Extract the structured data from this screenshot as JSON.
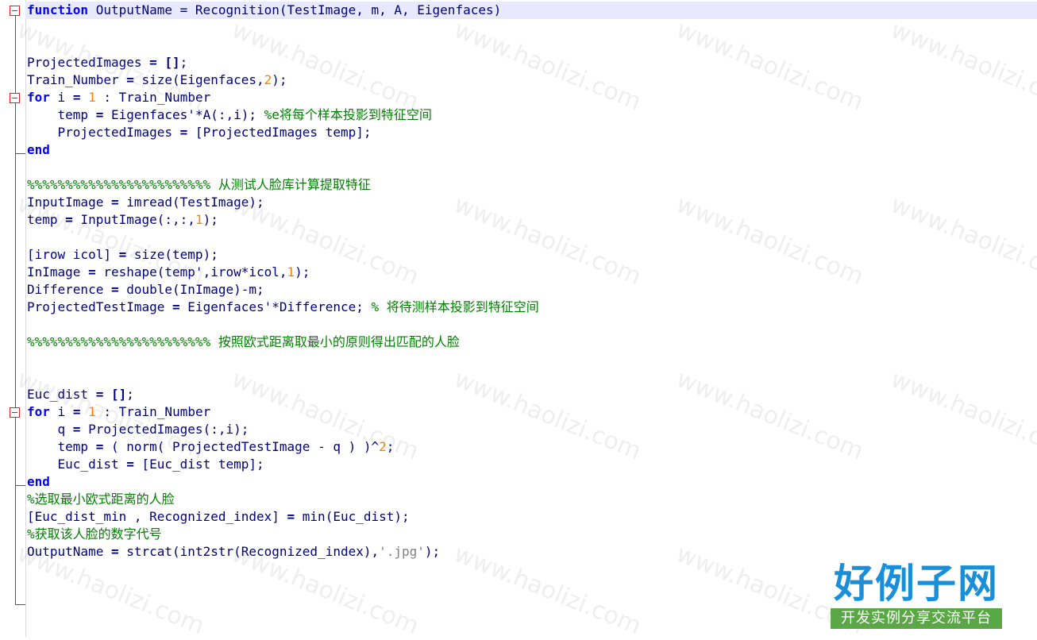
{
  "editor": {
    "lines": [
      [
        {
          "t": "kw",
          "v": "function"
        },
        {
          "t": "p",
          "v": " OutputName = Recognition(TestImage, m, A, Eigenfaces)"
        }
      ],
      [],
      [],
      [
        {
          "t": "p",
          "v": "ProjectedImages "
        },
        {
          "t": "op",
          "v": "= []"
        },
        {
          "t": "p",
          "v": ";"
        }
      ],
      [
        {
          "t": "p",
          "v": "Train_Number "
        },
        {
          "t": "op",
          "v": "="
        },
        {
          "t": "p",
          "v": " size(Eigenfaces,"
        },
        {
          "t": "num",
          "v": "2"
        },
        {
          "t": "p",
          "v": ");"
        }
      ],
      [
        {
          "t": "kw",
          "v": "for"
        },
        {
          "t": "p",
          "v": " i "
        },
        {
          "t": "op",
          "v": "="
        },
        {
          "t": "p",
          "v": " "
        },
        {
          "t": "num",
          "v": "1"
        },
        {
          "t": "p",
          "v": " : Train_Number"
        }
      ],
      [
        {
          "t": "p",
          "v": "    temp "
        },
        {
          "t": "op",
          "v": "="
        },
        {
          "t": "p",
          "v": " Eigenfaces'*A(:,i); "
        },
        {
          "t": "cm",
          "v": "%e将每个样本投影到特征空间"
        }
      ],
      [
        {
          "t": "p",
          "v": "    ProjectedImages "
        },
        {
          "t": "op",
          "v": "="
        },
        {
          "t": "p",
          "v": " [ProjectedImages temp];"
        }
      ],
      [
        {
          "t": "kw",
          "v": "end"
        }
      ],
      [],
      [
        {
          "t": "cm",
          "v": "%%%%%%%%%%%%%%%%%%%%%%%% 从测试人脸库计算提取特征"
        }
      ],
      [
        {
          "t": "p",
          "v": "InputImage "
        },
        {
          "t": "op",
          "v": "="
        },
        {
          "t": "p",
          "v": " imread(TestImage);"
        }
      ],
      [
        {
          "t": "p",
          "v": "temp "
        },
        {
          "t": "op",
          "v": "="
        },
        {
          "t": "p",
          "v": " InputImage(:,:,"
        },
        {
          "t": "num",
          "v": "1"
        },
        {
          "t": "p",
          "v": ");"
        }
      ],
      [],
      [
        {
          "t": "p",
          "v": "[irow icol] "
        },
        {
          "t": "op",
          "v": "="
        },
        {
          "t": "p",
          "v": " size(temp);"
        }
      ],
      [
        {
          "t": "p",
          "v": "InImage "
        },
        {
          "t": "op",
          "v": "="
        },
        {
          "t": "p",
          "v": " reshape(temp',irow*icol,"
        },
        {
          "t": "num",
          "v": "1"
        },
        {
          "t": "p",
          "v": ");"
        }
      ],
      [
        {
          "t": "p",
          "v": "Difference "
        },
        {
          "t": "op",
          "v": "="
        },
        {
          "t": "p",
          "v": " double(InImage)-m;"
        }
      ],
      [
        {
          "t": "p",
          "v": "ProjectedTestImage "
        },
        {
          "t": "op",
          "v": "="
        },
        {
          "t": "p",
          "v": " Eigenfaces'*Difference; "
        },
        {
          "t": "cm",
          "v": "% 将待测样本投影到特征空间"
        }
      ],
      [],
      [
        {
          "t": "cm",
          "v": "%%%%%%%%%%%%%%%%%%%%%%%% 按照欧式距离取最小的原则得出匹配的人脸"
        }
      ],
      [],
      [],
      [
        {
          "t": "p",
          "v": "Euc_dist "
        },
        {
          "t": "op",
          "v": "= []"
        },
        {
          "t": "p",
          "v": ";"
        }
      ],
      [
        {
          "t": "kw",
          "v": "for"
        },
        {
          "t": "p",
          "v": " i "
        },
        {
          "t": "op",
          "v": "="
        },
        {
          "t": "p",
          "v": " "
        },
        {
          "t": "num",
          "v": "1"
        },
        {
          "t": "p",
          "v": " : Train_Number"
        }
      ],
      [
        {
          "t": "p",
          "v": "    q "
        },
        {
          "t": "op",
          "v": "="
        },
        {
          "t": "p",
          "v": " ProjectedImages(:,i);"
        }
      ],
      [
        {
          "t": "p",
          "v": "    temp "
        },
        {
          "t": "op",
          "v": "="
        },
        {
          "t": "p",
          "v": " ( norm( ProjectedTestImage - q ) )^"
        },
        {
          "t": "num",
          "v": "2"
        },
        {
          "t": "p",
          "v": ";"
        }
      ],
      [
        {
          "t": "p",
          "v": "    Euc_dist "
        },
        {
          "t": "op",
          "v": "="
        },
        {
          "t": "p",
          "v": " [Euc_dist temp];"
        }
      ],
      [
        {
          "t": "kw",
          "v": "end"
        }
      ],
      [
        {
          "t": "cm",
          "v": "%选取最小欧式距离的人脸"
        }
      ],
      [
        {
          "t": "p",
          "v": "[Euc_dist_min , Recognized_index] "
        },
        {
          "t": "op",
          "v": "="
        },
        {
          "t": "p",
          "v": " min(Euc_dist);"
        }
      ],
      [
        {
          "t": "cm",
          "v": "%获取该人脸的数字代号"
        }
      ],
      [
        {
          "t": "p",
          "v": "OutputName "
        },
        {
          "t": "op",
          "v": "="
        },
        {
          "t": "p",
          "v": " strcat(int2str(Recognized_index),"
        },
        {
          "t": "str",
          "v": "'.jpg'"
        },
        {
          "t": "p",
          "v": ");"
        }
      ]
    ]
  },
  "watermark": {
    "text": "www.haolizi.com"
  },
  "logo": {
    "title": "好例子网",
    "subtitle": "开发实例分享交流平台"
  },
  "colors": {
    "keyword": "#0000ff",
    "number": "#ff8000",
    "comment": "#008000",
    "code": "#000080",
    "fold": "#e02020"
  }
}
